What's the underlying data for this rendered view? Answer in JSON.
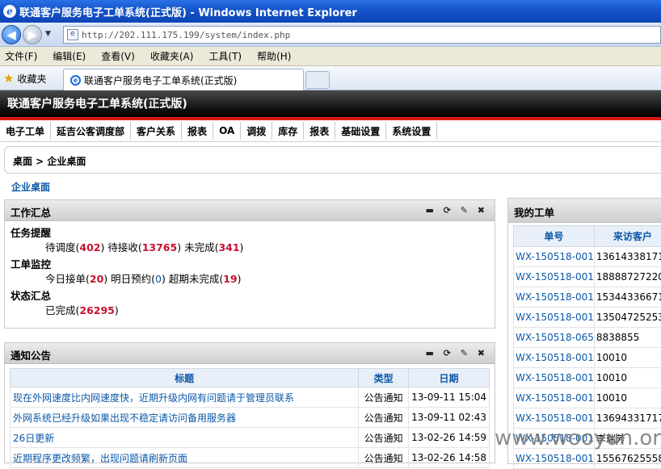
{
  "window": {
    "title": "联通客户服务电子工单系统(正式版) - Windows Internet Explorer",
    "ie_glyph": "e"
  },
  "address": {
    "url": "http://202.111.175.199/system/index.php"
  },
  "menu": [
    "文件(F)",
    "编辑(E)",
    "查看(V)",
    "收藏夹(A)",
    "工具(T)",
    "帮助(H)"
  ],
  "favorites": {
    "label": "收藏夹"
  },
  "tab": {
    "title": "联通客户服务电子工单系统(正式版)"
  },
  "app": {
    "title": "联通客户服务电子工单系统(正式版)"
  },
  "nav": [
    "电子工单",
    "延吉公客调度部",
    "客户关系",
    "报表",
    "OA",
    "调拨",
    "库存",
    "报表",
    "基础设置",
    "系统设置"
  ],
  "breadcrumb": "桌面 > 企业桌面",
  "enterprise_link": "企业桌面",
  "work": {
    "title": "工作汇总",
    "icons": "▬ ⟳ ✎ ✖",
    "reminder": {
      "label": "任务提醒",
      "l1": "待调度(",
      "v1": "402",
      "l2": ") 待接收(",
      "v2": "13765",
      "l3": ") 未完成(",
      "v3": "341",
      "l4": ")"
    },
    "monitor": {
      "label": "工单监控",
      "l1": "今日接单(",
      "v1": "20",
      "l2": ") 明日预约(",
      "v2": "0",
      "l3": ") 超期未完成(",
      "v3": "19",
      "l4": ")"
    },
    "status": {
      "label": "状态汇总",
      "l1": "已完成(",
      "v1": "26295",
      "l2": ")"
    }
  },
  "notice": {
    "title": "通知公告",
    "icons": "▬ ⟳ ✎ ✖",
    "headers": [
      "标题",
      "类型",
      "日期"
    ],
    "rows": [
      [
        "现在外网速度比内网速度快，近期升级内网有问题请于管理员联系",
        "公告通知",
        "13-09-11 15:04"
      ],
      [
        "外网系统已经升级如果出现不稳定请访问备用服务器",
        "公告通知",
        "13-09-11 02:43"
      ],
      [
        "26日更新",
        "公告通知",
        "13-02-26 14:59"
      ],
      [
        "近期程序更改频繁，出现问题请刷新页面",
        "公告通知",
        "13-02-26 14:58"
      ]
    ]
  },
  "orders": {
    "title": "我的工单",
    "headers": [
      "单号",
      "来访客户"
    ],
    "rows": [
      [
        "WX-150518-001",
        "13614338171"
      ],
      [
        "WX-150518-001",
        "18888727220"
      ],
      [
        "WX-150518-001",
        "15344336671"
      ],
      [
        "WX-150518-001",
        "13504725253"
      ],
      [
        "WX-150518-065",
        "8838855"
      ],
      [
        "WX-150518-001",
        "10010"
      ],
      [
        "WX-150518-001",
        "10010"
      ],
      [
        "WX-150518-001",
        "10010"
      ],
      [
        "WX-150518-001",
        "13694331717"
      ],
      [
        "WX-150518-001",
        "李瑞芳"
      ],
      [
        "WX-150518-001",
        "15567625558"
      ]
    ]
  },
  "watermark": "www.wooyun.org"
}
